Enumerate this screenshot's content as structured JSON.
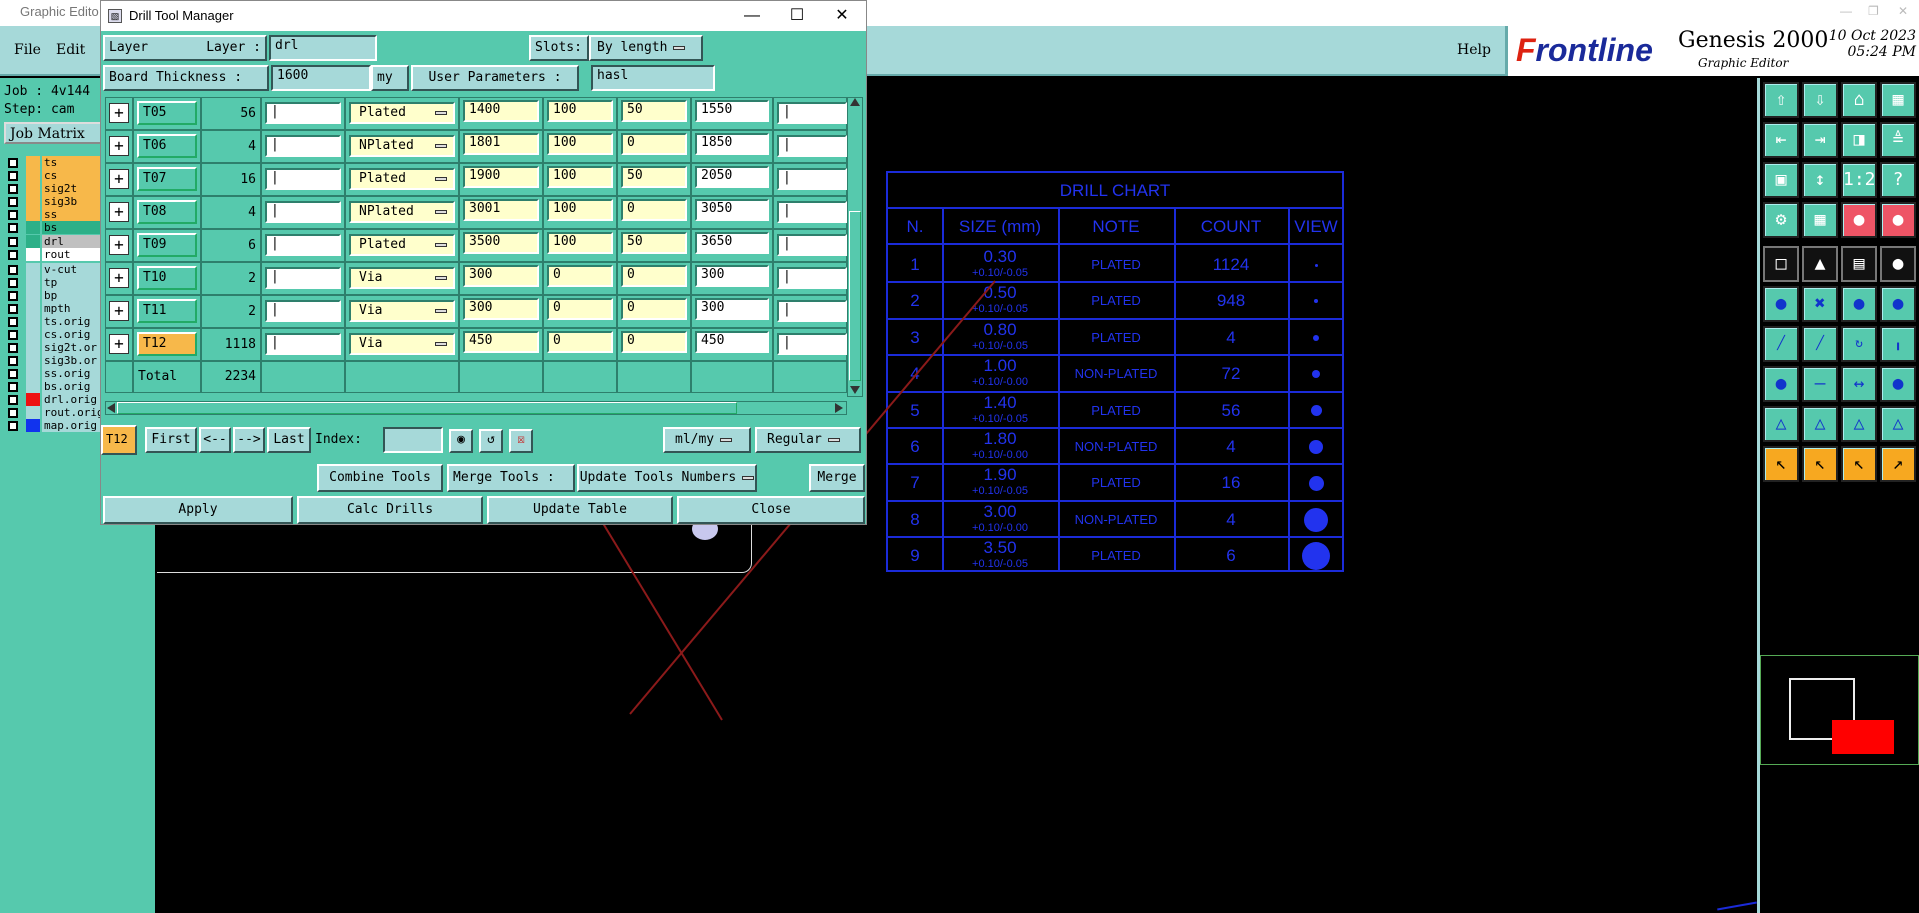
{
  "app": {
    "title": "Graphic Edito",
    "menus": [
      "File",
      "Edit"
    ],
    "help": "Help",
    "brand_logo_first": "F",
    "brand_logo_rest": "rontline",
    "brand_name": "Genesis 2000",
    "brand_subtitle": "Graphic Editor",
    "date": "10 Oct 2023",
    "time": "05:24 PM"
  },
  "left_panel": {
    "job": "Job : 4v144",
    "step": "Step: cam",
    "job_matrix": "Job Matrix",
    "layers": [
      {
        "name": "ts",
        "color": "#f7b84a",
        "swatch": "#f7b84a"
      },
      {
        "name": "cs",
        "color": "#f7b84a",
        "swatch": "#f7b84a"
      },
      {
        "name": "sig2t",
        "color": "#f7b84a",
        "swatch": "#f7b84a"
      },
      {
        "name": "sig3b",
        "color": "#f7b84a",
        "swatch": "#f7b84a"
      },
      {
        "name": "ss",
        "color": "#f7b84a",
        "swatch": "#f7b84a"
      },
      {
        "name": "bs",
        "color": "#2db088",
        "swatch": "#2db088"
      },
      {
        "name": "drl",
        "color": "#c0c0c0",
        "swatch": "#2db088"
      },
      {
        "name": "rout",
        "color": "#ffffff",
        "swatch": "#ffffff"
      },
      {
        "name": "v-cut",
        "color": "#a6d9d9",
        "swatch": "#a6d9d9"
      },
      {
        "name": "tp",
        "color": "#a6d9d9",
        "swatch": "#a6d9d9"
      },
      {
        "name": "bp",
        "color": "#a6d9d9",
        "swatch": "#a6d9d9"
      },
      {
        "name": "mpth",
        "color": "#a6d9d9",
        "swatch": "#a6d9d9"
      },
      {
        "name": "ts.orig",
        "color": "#a6d9d9",
        "swatch": "#a6d9d9"
      },
      {
        "name": "cs.orig",
        "color": "#a6d9d9",
        "swatch": "#a6d9d9"
      },
      {
        "name": "sig2t.or",
        "color": "#a6d9d9",
        "swatch": "#a6d9d9"
      },
      {
        "name": "sig3b.or",
        "color": "#a6d9d9",
        "swatch": "#a6d9d9"
      },
      {
        "name": "ss.orig",
        "color": "#a6d9d9",
        "swatch": "#a6d9d9"
      },
      {
        "name": "bs.orig",
        "color": "#a6d9d9",
        "swatch": "#a6d9d9"
      },
      {
        "name": "drl.orig",
        "color": "#a6d9d9",
        "swatch": "#ee1111"
      },
      {
        "name": "rout.orig",
        "color": "#a6d9d9",
        "swatch": "#a6d9d9"
      },
      {
        "name": "map.orig",
        "color": "#a6d9d9",
        "swatch": "#1133ee"
      }
    ]
  },
  "dialog": {
    "title": "Drill Tool Manager",
    "layer_label": "Layer :",
    "layer_value": "drl",
    "slots_label": "Slots:",
    "slots_value": "By length",
    "board_thickness_label": "Board Thickness :",
    "board_thickness_value": "1600",
    "board_thickness_unit": "my",
    "user_params_label": "User Parameters :",
    "user_params_value": "hasl",
    "rows": [
      {
        "tool": "T05",
        "count": "56",
        "type": "Plated",
        "finish": "1400",
        "tol_plus": "100",
        "tol_minus": "50",
        "drill": "1550"
      },
      {
        "tool": "T06",
        "count": "4",
        "type": "NPlated",
        "finish": "1801",
        "tol_plus": "100",
        "tol_minus": "0",
        "drill": "1850"
      },
      {
        "tool": "T07",
        "count": "16",
        "type": "Plated",
        "finish": "1900",
        "tol_plus": "100",
        "tol_minus": "50",
        "drill": "2050"
      },
      {
        "tool": "T08",
        "count": "4",
        "type": "NPlated",
        "finish": "3001",
        "tol_plus": "100",
        "tol_minus": "0",
        "drill": "3050"
      },
      {
        "tool": "T09",
        "count": "6",
        "type": "Plated",
        "finish": "3500",
        "tol_plus": "100",
        "tol_minus": "50",
        "drill": "3650"
      },
      {
        "tool": "T10",
        "count": "2",
        "type": "Via",
        "finish": "300",
        "tol_plus": "0",
        "tol_minus": "0",
        "drill": "300"
      },
      {
        "tool": "T11",
        "count": "2",
        "type": "Via",
        "finish": "300",
        "tol_plus": "0",
        "tol_minus": "0",
        "drill": "300"
      },
      {
        "tool": "T12",
        "count": "1118",
        "type": "Via",
        "finish": "450",
        "tol_plus": "0",
        "tol_minus": "0",
        "drill": "450"
      }
    ],
    "total_label": "Total",
    "total_value": "2234",
    "current_tool": "T12",
    "nav": {
      "first": "First",
      "prev": "<--",
      "next": "-->",
      "last": "Last",
      "index_label": "Index:"
    },
    "units": "ml/my",
    "mode": "Regular",
    "combine_tools": "Combine Tools",
    "merge_tools_label": "Merge Tools :",
    "merge_tools_value": "Update Tools Numbers",
    "merge": "Merge",
    "apply": "Apply",
    "calc_drills": "Calc Drills",
    "update_table": "Update Table",
    "close": "Close"
  },
  "drill_chart": {
    "title": "DRILL CHART",
    "headers": [
      "N.",
      "SIZE (mm)",
      "NOTE",
      "COUNT",
      "VIEW"
    ],
    "rows": [
      {
        "n": "1",
        "size": "0.30",
        "tol": "+0.10/-0.05",
        "note": "PLATED",
        "count": "1124",
        "dot": 3
      },
      {
        "n": "2",
        "size": "0.50",
        "tol": "+0.10/-0.05",
        "note": "PLATED",
        "count": "948",
        "dot": 4
      },
      {
        "n": "3",
        "size": "0.80",
        "tol": "+0.10/-0.05",
        "note": "PLATED",
        "count": "4",
        "dot": 6
      },
      {
        "n": "4",
        "size": "1.00",
        "tol": "+0.10/-0.00",
        "note": "NON-PLATED",
        "count": "72",
        "dot": 8
      },
      {
        "n": "5",
        "size": "1.40",
        "tol": "+0.10/-0.05",
        "note": "PLATED",
        "count": "56",
        "dot": 11
      },
      {
        "n": "6",
        "size": "1.80",
        "tol": "+0.10/-0.00",
        "note": "NON-PLATED",
        "count": "4",
        "dot": 14
      },
      {
        "n": "7",
        "size": "1.90",
        "tol": "+0.10/-0.05",
        "note": "PLATED",
        "count": "16",
        "dot": 15
      },
      {
        "n": "8",
        "size": "3.00",
        "tol": "+0.10/-0.00",
        "note": "NON-PLATED",
        "count": "4",
        "dot": 24
      },
      {
        "n": "9",
        "size": "3.50",
        "tol": "+0.10/-0.05",
        "note": "PLATED",
        "count": "6",
        "dot": 28
      }
    ]
  },
  "toolbar_icons": [
    "open-job-icon",
    "save-icon",
    "home-icon",
    "layout-icon",
    "import-icon",
    "export-icon",
    "step-icon",
    "split-icon",
    "fit-icon",
    "zoom-icon",
    "scale-icon",
    "help-icon",
    "snap-icon",
    "grid-icon",
    "layer-icon",
    "measure-icon",
    "pad-icon",
    "shape-icon",
    "ruler-icon",
    "dot-icon",
    "connect-icon",
    "cross-icon",
    "node-icon",
    "link-icon",
    "line-icon",
    "draw-icon",
    "arc-icon",
    "edge-icon",
    "route-icon",
    "dash-icon",
    "dim-icon",
    "fill-icon",
    "triangle-icon",
    "peak-icon",
    "bridge-icon",
    "arch-icon",
    "pointer-icon",
    "select-icon",
    "move-icon",
    "path-icon"
  ]
}
